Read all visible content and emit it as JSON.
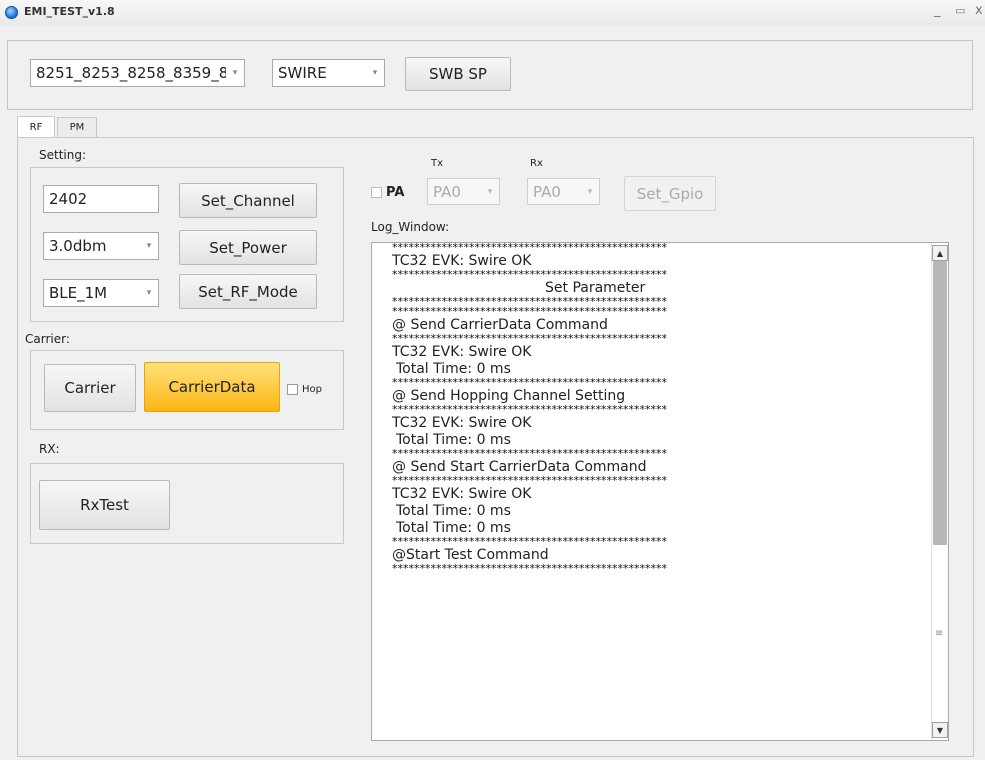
{
  "window": {
    "title": "EMI_TEST_v1.8",
    "min_glyph": "_",
    "max_glyph": "▭",
    "close_glyph": "x"
  },
  "top": {
    "chip_combo": "8251_8253_8258_8359_8",
    "interface_combo": "SWIRE",
    "swb_sp_button": "SWB SP"
  },
  "tabs": [
    "RF",
    "PM"
  ],
  "setting": {
    "label": "Setting:",
    "channel_value": "2402",
    "set_channel": "Set_Channel",
    "power_value": "3.0dbm",
    "set_power": "Set_Power",
    "rf_mode_value": "BLE_1M",
    "set_rf_mode": "Set_RF_Mode"
  },
  "carrier": {
    "label": "Carrier:",
    "carrier_button": "Carrier",
    "carrierdata_button": "CarrierData",
    "hop_label": "Hop"
  },
  "rx": {
    "label": "RX:",
    "rxtest_button": "RxTest"
  },
  "gpio": {
    "tx_label": "Tx",
    "rx_label": "Rx",
    "pa_label": "PA",
    "tx_value": "PA0",
    "rx_value": "PA0",
    "set_gpio": "Set_Gpio"
  },
  "log": {
    "label": "Log_Window:",
    "stars": "**************************************************",
    "lines": [
      {
        "type": "stars"
      },
      {
        "type": "text",
        "text": "TC32 EVK: Swire OK"
      },
      {
        "type": "stars"
      },
      {
        "type": "center",
        "text": "Set Parameter"
      },
      {
        "type": "stars"
      },
      {
        "type": "stars"
      },
      {
        "type": "text",
        "text": "@ Send CarrierData Command"
      },
      {
        "type": "stars"
      },
      {
        "type": "text",
        "text": "TC32 EVK: Swire OK"
      },
      {
        "type": "indent",
        "text": "Total Time: 0 ms"
      },
      {
        "type": "stars"
      },
      {
        "type": "text",
        "text": "@ Send Hopping Channel Setting"
      },
      {
        "type": "stars"
      },
      {
        "type": "text",
        "text": "TC32 EVK: Swire OK"
      },
      {
        "type": "indent",
        "text": "Total Time: 0 ms"
      },
      {
        "type": "stars"
      },
      {
        "type": "text",
        "text": "@ Send Start CarrierData Command"
      },
      {
        "type": "stars"
      },
      {
        "type": "text",
        "text": "TC32 EVK: Swire OK"
      },
      {
        "type": "indent",
        "text": "Total Time: 0 ms"
      },
      {
        "type": "indent",
        "text": "Total Time: 0 ms"
      },
      {
        "type": "stars"
      },
      {
        "type": "text",
        "text": "@Start Test Command"
      },
      {
        "type": "stars"
      }
    ]
  },
  "scroll": {
    "up": "▲",
    "down": "▼",
    "grip": "≡"
  }
}
